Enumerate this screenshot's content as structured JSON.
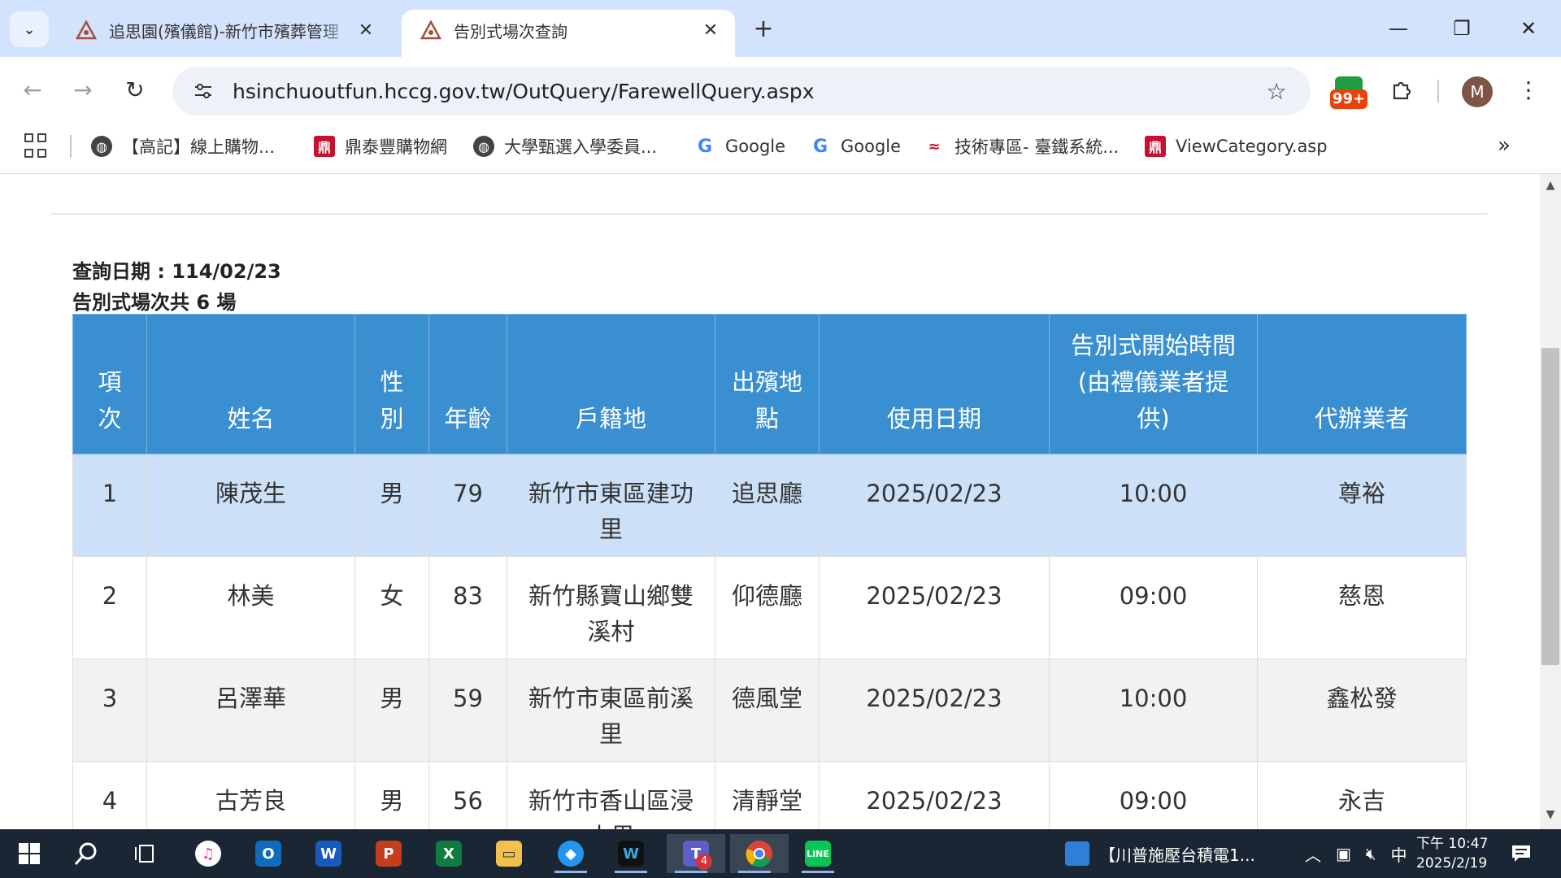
{
  "browser": {
    "tabs": [
      {
        "title": "追思園(殯儀館)-新竹市殯葬管理",
        "close": "✕",
        "favicon": "temple-favicon"
      },
      {
        "title": "告別式場次查詢",
        "close": "✕",
        "favicon": "temple-favicon"
      }
    ],
    "new_tab": "+",
    "url": "hsinchuoutfun.hccg.gov.tw/OutQuery/FarewellQuery.aspx",
    "extension_badge": "99+",
    "avatar_letter": "M",
    "bookmarks": [
      {
        "label": "【高記】線上購物...",
        "icon": "globe-icon"
      },
      {
        "label": "鼎泰豐購物網",
        "icon": "dintaifung-icon"
      },
      {
        "label": "大學甄選入學委員...",
        "icon": "globe-icon"
      },
      {
        "label": "Google",
        "icon": "google-icon"
      },
      {
        "label": "Google",
        "icon": "google-icon"
      },
      {
        "label": "技術專區- 臺鐵系統...",
        "icon": "railway-icon"
      },
      {
        "label": "ViewCategory.asp",
        "icon": "dintaifung-icon"
      }
    ],
    "bookmarks_overflow": "»"
  },
  "page": {
    "query_date": "查詢日期 : 114/02/23",
    "session_count": "告別式場次共 6 場",
    "table": {
      "headers": [
        "項次",
        "姓名",
        "性別",
        "年齡",
        "戶籍地",
        "出殯地點",
        "使用日期",
        "告別式開始時間(由禮儀業者提供)",
        "代辦業者"
      ],
      "rows": [
        [
          "1",
          "陳茂生",
          "男",
          "79",
          "新竹市東區建功里",
          "追思廳",
          "2025/02/23",
          "10:00",
          "尊裕"
        ],
        [
          "2",
          "林美",
          "女",
          "83",
          "新竹縣寶山鄉雙溪村",
          "仰德廳",
          "2025/02/23",
          "09:00",
          "慈恩"
        ],
        [
          "3",
          "呂澤華",
          "男",
          "59",
          "新竹市東區前溪里",
          "德風堂",
          "2025/02/23",
          "10:00",
          "鑫松發"
        ],
        [
          "4",
          "古芳良",
          "男",
          "56",
          "新竹市香山區浸水里",
          "清靜堂",
          "2025/02/23",
          "09:00",
          "永吉"
        ]
      ]
    },
    "colors": {
      "header_bg": "#3a8fd1",
      "highlight_row": "#cce0f7",
      "alt_row": "#f2f2f2"
    }
  },
  "taskbar": {
    "window_label": "【川普施壓台積電1...",
    "ime": "中",
    "clock_time": "下午 10:47",
    "clock_date": "2025/2/19",
    "teams_badge": "4"
  }
}
